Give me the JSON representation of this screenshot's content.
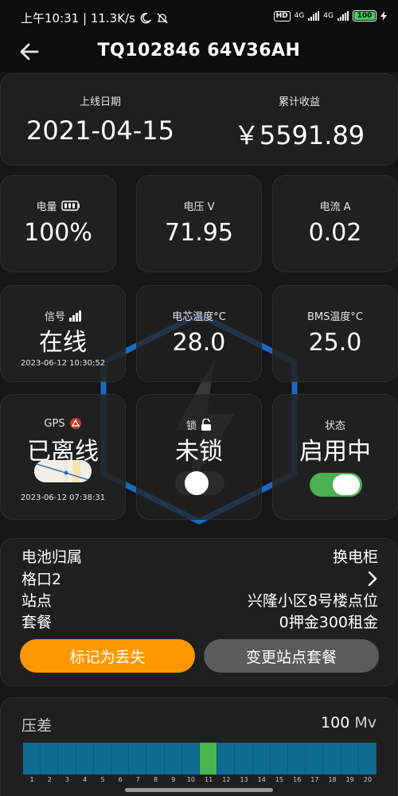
{
  "statusbar": {
    "time_speed": "上午10:31 | 11.3K/s",
    "hd": "HD",
    "net1": "4G",
    "net2": "4G",
    "battery": "100"
  },
  "header": {
    "title": "TQ102846 64V36AH"
  },
  "summary": {
    "online_date_label": "上线日期",
    "online_date": "2021-04-15",
    "earnings_label": "累计收益",
    "earnings": "￥5591.89"
  },
  "metrics": {
    "power_label": "电量",
    "power_value": "100%",
    "voltage_label": "电压 V",
    "voltage_value": "71.95",
    "current_label": "电流 A",
    "current_value": "0.02",
    "signal_label": "信号",
    "signal_value": "在线",
    "signal_time": "2023-06-12 10:30:52",
    "cell_temp_label": "电芯温度°C",
    "cell_temp_value": "28.0",
    "bms_temp_label": "BMS温度°C",
    "bms_temp_value": "25.0",
    "gps_label": "GPS",
    "gps_value": "已离线",
    "gps_time": "2023-06-12 07:38:31",
    "lock_label": "锁",
    "lock_value": "未锁",
    "lock_on": false,
    "status_label": "状态",
    "status_value": "启用中",
    "status_on": true
  },
  "info": {
    "ownership_label": "电池归属",
    "ownership_value": "换电柜",
    "slot_label": "格口2",
    "station_label": "站点",
    "station_value": "兴隆小区8号楼点位",
    "package_label": "套餐",
    "package_value": "0押金300租金",
    "btn_lost": "标记为丢失",
    "btn_change": "变更站点套餐"
  },
  "diff": {
    "label": "压差",
    "value": "100",
    "unit": "Mv",
    "cells": [
      "1",
      "2",
      "3",
      "4",
      "5",
      "6",
      "7",
      "8",
      "9",
      "10",
      "11",
      "12",
      "13",
      "14",
      "15",
      "16",
      "17",
      "18",
      "19",
      "20"
    ],
    "highlight_cell": "11"
  },
  "colors": {
    "accent_orange": "#ff9800",
    "toggle_green": "#4caf50",
    "cell_blue": "#0d6c8f",
    "cell_green": "#4cb550",
    "watermark_blue": "#1a6fd0"
  }
}
